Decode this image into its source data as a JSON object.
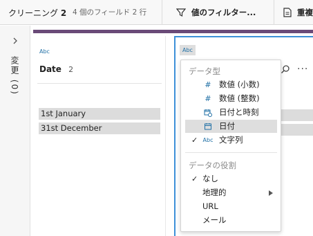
{
  "toolbar": {
    "step_name": "クリーニング",
    "step_number": "2",
    "info": "4 個のフィールド  2 行",
    "filter_label": "値のフィルター...",
    "group_label": "重複"
  },
  "rail": {
    "label": "変更 (0)"
  },
  "column1": {
    "type_tag": "Abc",
    "name": "Date",
    "count": "2",
    "values": [
      "1st January",
      "31st December"
    ]
  },
  "column2": {
    "type_tag": "Abc"
  },
  "menu": {
    "data_type_header": "データ型",
    "data_types": [
      {
        "icon": "#",
        "label": "数値 (小数)"
      },
      {
        "icon": "#",
        "label": "数値 (整数)"
      },
      {
        "icon": "datetime",
        "label": "日付と時刻"
      },
      {
        "icon": "date",
        "label": "日付"
      },
      {
        "icon": "Abc",
        "label": "文字列",
        "checked": true
      }
    ],
    "role_header": "データの役割",
    "roles": [
      {
        "label": "なし",
        "checked": true
      },
      {
        "label": "地理的",
        "submenu": true
      },
      {
        "label": "URL"
      },
      {
        "label": "メール"
      }
    ]
  },
  "colors": {
    "accent_purple": "#6a4a78",
    "selection_blue": "#3c8fd8",
    "type_blue": "#1f6fa5"
  }
}
